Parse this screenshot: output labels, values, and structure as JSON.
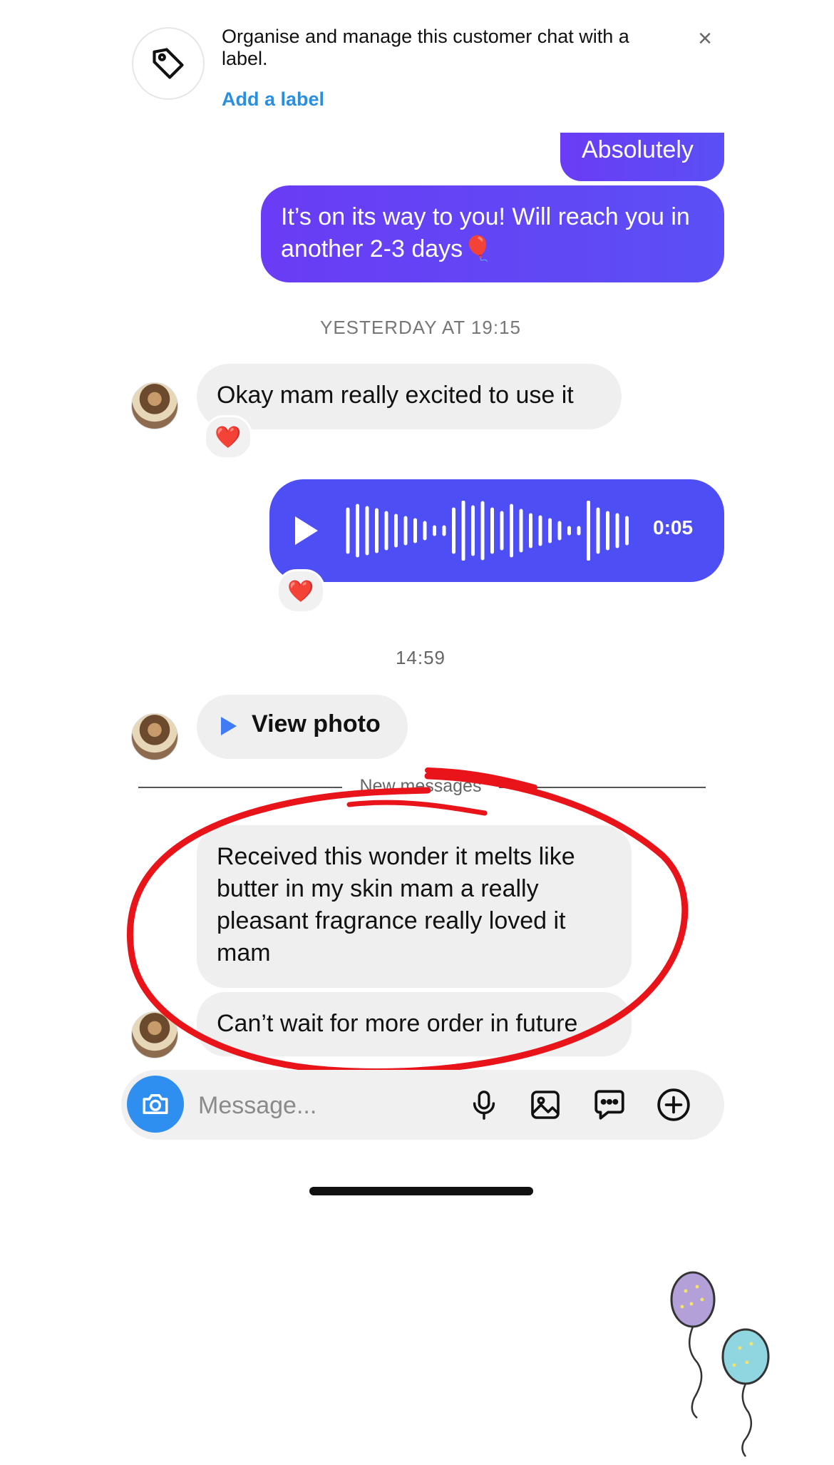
{
  "banner": {
    "text": "Organise and manage this customer chat with a label.",
    "link_label": "Add a label",
    "close_symbol": "×",
    "icon": "tag-icon"
  },
  "messages": {
    "out_1": "Absolutely",
    "out_2": "It’s on its way to you! Will reach you in another 2-3 days🎈",
    "timestamp_1": "YESTERDAY AT 19:15",
    "in_1": "Okay mam really excited to use it",
    "in_1_reaction": "❤️",
    "voice_duration": "0:05",
    "voice_reaction": "❤️",
    "timestamp_2": "14:59",
    "view_photo_label": "View photo",
    "new_messages_label": "New messages",
    "in_2": "Received this wonder it melts like butter in my skin mam a really pleasant fragrance really loved it mam",
    "in_3": "Can’t wait for more order in future"
  },
  "composer": {
    "placeholder": "Message...",
    "icons": [
      "camera-icon",
      "microphone-icon",
      "gallery-icon",
      "sticker-chat-icon",
      "plus-icon"
    ]
  },
  "colors": {
    "outgoing_bubble": "#5b4ff5",
    "incoming_bubble": "#efefef",
    "link": "#2b8fe0",
    "camera_button": "#2e8ff0",
    "annotation_circle": "#e8141a"
  }
}
